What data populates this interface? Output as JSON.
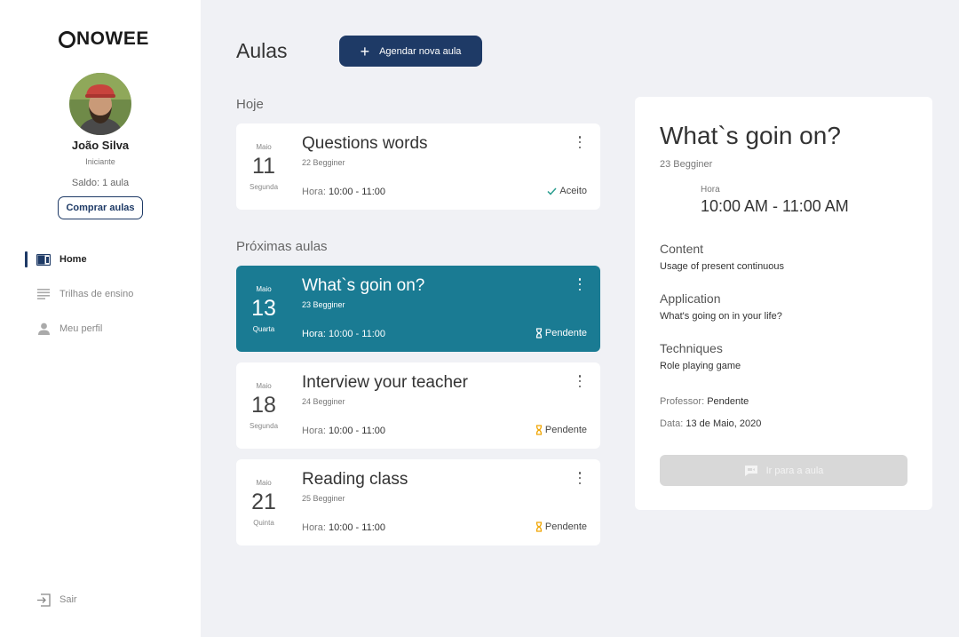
{
  "brand": {
    "logo_text": "NOWEE"
  },
  "user": {
    "name": "João Silva",
    "level": "Iniciante",
    "balance": "Saldo: 1 aula",
    "buy_label": "Comprar aulas"
  },
  "nav": {
    "items": [
      {
        "label": "Home",
        "icon": "dashboard-icon",
        "active": true
      },
      {
        "label": "Trilhas de ensino",
        "icon": "list-icon",
        "active": false
      },
      {
        "label": "Meu perfil",
        "icon": "person-icon",
        "active": false
      }
    ],
    "logout": {
      "label": "Sair",
      "icon": "logout-icon"
    }
  },
  "main": {
    "title": "Aulas",
    "schedule_label": "Agendar nova aula",
    "today_label": "Hoje",
    "upcoming_label": "Próximas aulas",
    "time_prefix": "Hora:",
    "today": [
      {
        "month": "Maio",
        "day": "11",
        "weekday": "Segunda",
        "title": "Questions words",
        "level": "22 Begginer",
        "time": "10:00 - 11:00",
        "status": "Aceito",
        "status_icon": "check-icon"
      }
    ],
    "upcoming": [
      {
        "month": "Maio",
        "day": "13",
        "weekday": "Quarta",
        "title": "What`s goin on?",
        "level": "23 Begginer",
        "time": "10:00 - 11:00",
        "status": "Pendente",
        "status_icon": "hourglass-icon"
      },
      {
        "month": "Maio",
        "day": "18",
        "weekday": "Segunda",
        "title": "Interview your teacher",
        "level": "24 Begginer",
        "time": "10:00 - 11:00",
        "status": "Pendente",
        "status_icon": "hourglass-icon"
      },
      {
        "month": "Maio",
        "day": "21",
        "weekday": "Quinta",
        "title": "Reading class",
        "level": "25 Begginer",
        "time": "10:00 - 11:00",
        "status": "Pendente",
        "status_icon": "hourglass-icon"
      }
    ]
  },
  "detail": {
    "title": "What`s goin on?",
    "level": "23 Begginer",
    "hora_label": "Hora",
    "hora": "10:00 AM - 11:00 AM",
    "content_label": "Content",
    "content": "Usage of present continuous",
    "application_label": "Application",
    "application": "What's going on in your life?",
    "techniques_label": "Techniques",
    "techniques": "Role playing game",
    "professor_label": "Professor:",
    "professor": "Pendente",
    "date_label": "Data:",
    "date": "13 de Maio, 2020",
    "go_label": "Ir para a aula"
  },
  "colors": {
    "primary": "#1e3a66",
    "selected_card": "#1a7b93",
    "accepted": "#2a9d8f",
    "pending": "#f0a500",
    "background": "#f0f1f5",
    "disabled": "#d8d8d8"
  }
}
